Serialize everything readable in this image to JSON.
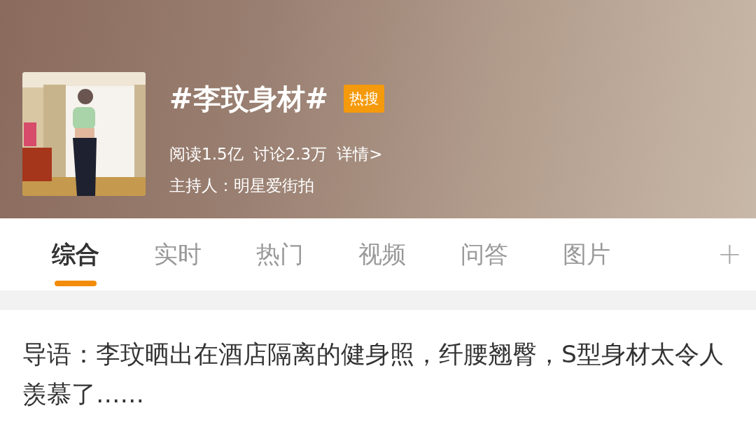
{
  "header": {
    "title": "#李玟身材#",
    "badge": "热搜",
    "stats": [
      {
        "label": "阅读1.5亿"
      },
      {
        "label": "讨论2.3万"
      }
    ],
    "detail_link": "详情>",
    "host": "主持人：明星爱街拍"
  },
  "tabs": [
    {
      "label": "综合",
      "selected": true
    },
    {
      "label": "实时",
      "selected": false
    },
    {
      "label": "热门",
      "selected": false
    },
    {
      "label": "视频",
      "selected": false
    },
    {
      "label": "问答",
      "selected": false
    },
    {
      "label": "图片",
      "selected": false
    }
  ],
  "add_tab": "+",
  "intro": "导语：李玟晒出在酒店隔离的健身照，纤腰翘臀，S型身材太令人羡慕了……"
}
